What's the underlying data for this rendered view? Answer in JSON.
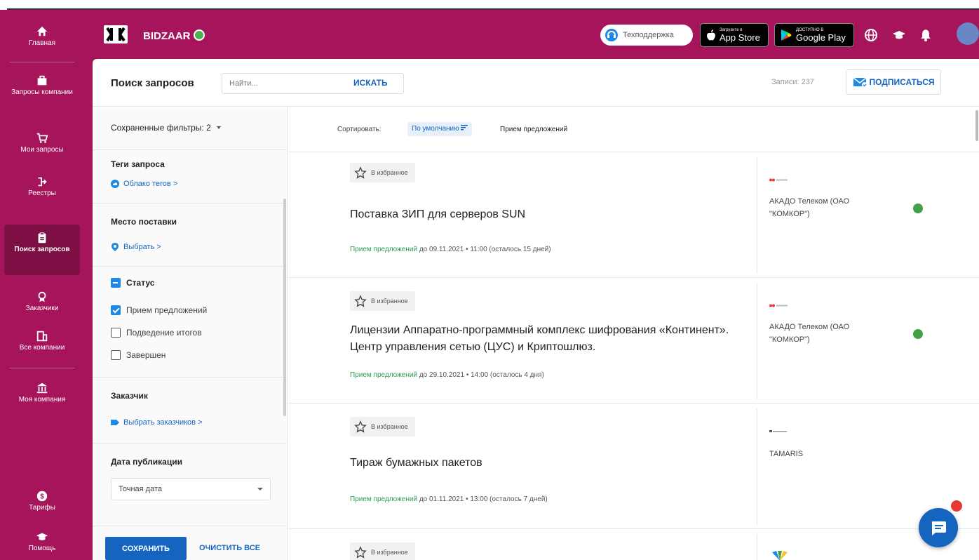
{
  "nav": {
    "items": [
      {
        "label": "Главная",
        "icon": "home-icon"
      },
      {
        "label": "Запросы компании",
        "icon": "briefcase-icon"
      },
      {
        "label": "Мои запросы",
        "icon": "cart-icon"
      },
      {
        "label": "Реестры",
        "icon": "registry-icon"
      },
      {
        "label": "Поиск запросов",
        "icon": "clipboard-icon"
      },
      {
        "label": "Заказчики",
        "icon": "award-icon"
      },
      {
        "label": "Все компании",
        "icon": "building-icon"
      },
      {
        "label": "Моя компания",
        "icon": "bank-icon"
      },
      {
        "label": "Тарифы",
        "icon": "dollar-icon"
      },
      {
        "label": "Помощь",
        "icon": "graduation-icon"
      }
    ]
  },
  "header": {
    "brand": "BIDZAAR",
    "support_label": "Техподдержка",
    "appstore_small": "Загрузите в",
    "appstore_big": "App Store",
    "googleplay_small": "ДОСТУПНО В",
    "googleplay_big": "Google Play"
  },
  "toolbar": {
    "title": "Поиск запросов",
    "search_placeholder": "Найти...",
    "search_button": "ИСКАТЬ",
    "records_label": "Записи: 237",
    "subscribe_button": "ПОДПИСАТЬСЯ"
  },
  "filters": {
    "saved": "Сохраненные фильтры: 2",
    "tags_title": "Теги запроса",
    "tags_link": "Облако тегов >",
    "place_title": "Место поставки",
    "place_link": "Выбрать >",
    "status_title": "Статус",
    "status_options": [
      {
        "label": "Прием предложений",
        "checked": true
      },
      {
        "label": "Подведение итогов",
        "checked": false
      },
      {
        "label": "Завершен",
        "checked": false
      }
    ],
    "customer_title": "Заказчик",
    "customer_link": "Выбрать заказчиков >",
    "date_title": "Дата публикации",
    "date_select": "Точная дата",
    "save_button": "СОХРАНИТЬ",
    "clear_button": "ОЧИСТИТЬ ВСЕ"
  },
  "sort": {
    "label": "Сортировать:",
    "selected": "По умолчанию",
    "option": "Прием предложений"
  },
  "results": [
    {
      "fav": "В избранное",
      "title": "Поставка ЗИП для серверов SUN",
      "status": "Прием предложений",
      "deadline": "до 09.11.2021 • 11:00 (осталось 15 дней)",
      "company": "АКАДО Телеком (ОАО \"КОМКОР\")",
      "verified": true
    },
    {
      "fav": "В избранное",
      "title": "Лицензии Аппаратно-программный комплекс шифрования «Континент». Центр управления сетью (ЦУС) и Криптошлюз.",
      "status": "Прием предложений",
      "deadline": "до 29.10.2021 • 14:00 (осталось 4 дня)",
      "company": "АКАДО Телеком (ОАО \"КОМКОР\")",
      "verified": true
    },
    {
      "fav": "В избранное",
      "title": "Тираж бумажных пакетов",
      "status": "Прием предложений",
      "deadline": "до 01.11.2021 • 13:00 (осталось 7 дней)",
      "company": "TAMARIS",
      "verified": false
    },
    {
      "fav": "В избранное",
      "title": "",
      "status": "",
      "deadline": "",
      "company": "",
      "verified": false
    }
  ],
  "colors": {
    "brand": "#a6155c",
    "accent": "#1565c0",
    "success": "#2e9e4f"
  }
}
